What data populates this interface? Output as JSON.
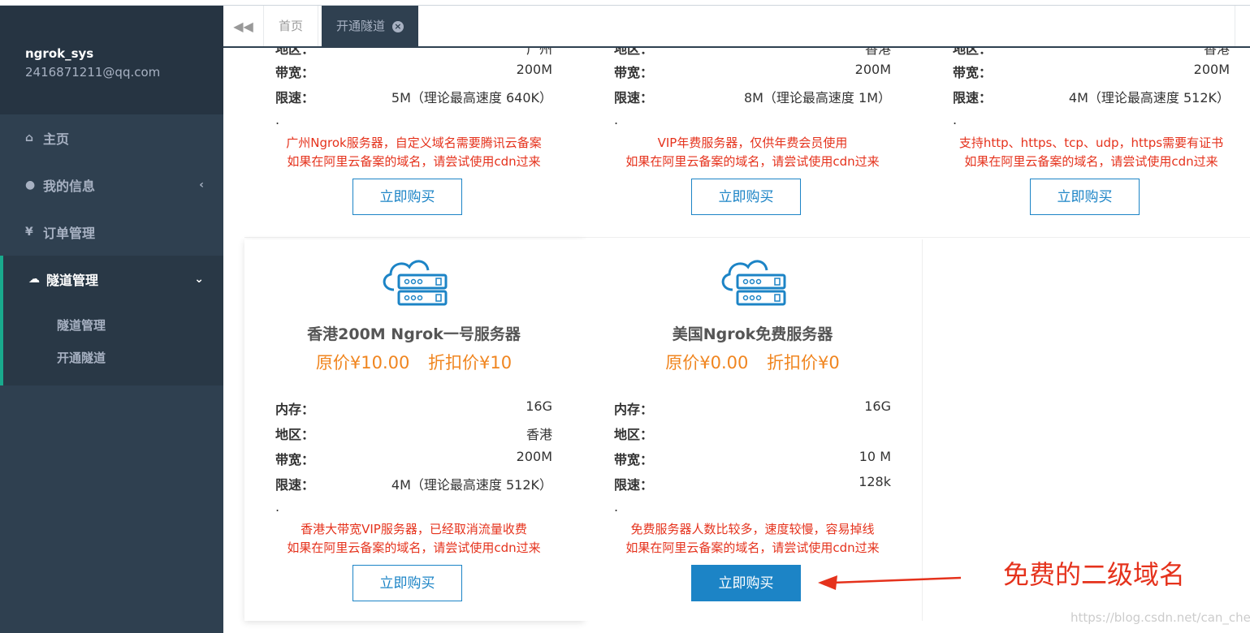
{
  "sidebar": {
    "username": "ngrok_sys",
    "email": "2416871211@qq.com",
    "items": [
      {
        "label": "主页",
        "icon": "home-icon"
      },
      {
        "label": "我的信息",
        "icon": "user-icon"
      },
      {
        "label": "订单管理",
        "icon": "yen-icon"
      },
      {
        "label": "隧道管理",
        "icon": "cloud-icon"
      }
    ],
    "submenu": [
      "隧道管理",
      "开通隧道"
    ]
  },
  "tabs": {
    "home": "首页",
    "active": "开通隧道"
  },
  "labels": {
    "memory": "内存：",
    "region": "地区：",
    "bandwidth": "带宽：",
    "speed": "限速：",
    "buy": "立即购买"
  },
  "top_cards": [
    {
      "region_partial": "广州",
      "bandwidth": "200M",
      "speed": "5M（理论最高速度 640K）",
      "dot": ".",
      "desc1": "广州Ngrok服务器，自定义域名需要腾讯云备案",
      "desc2": "如果在阿里云备案的域名，请尝试使用cdn过来"
    },
    {
      "region_partial": "香港",
      "bandwidth": "200M",
      "speed": "8M（理论最高速度 1M）",
      "dot": ".",
      "desc1": "VIP年费服务器，仅供年费会员使用",
      "desc2": "如果在阿里云备案的域名，请尝试使用cdn过来"
    },
    {
      "region_partial": "香港",
      "bandwidth": "200M",
      "speed": "4M（理论最高速度 512K）",
      "dot": ".",
      "desc1": "支持http、https、tcp、udp，https需要有证书",
      "desc2": "如果在阿里云备案的域名，请尝试使用cdn过来"
    }
  ],
  "bottom_cards": [
    {
      "title": "香港200M Ngrok一号服务器",
      "orig_price": "原价¥10.00",
      "disc_price": "折扣价¥10",
      "memory": "16G",
      "region": "香港",
      "bandwidth": "200M",
      "speed": "4M（理论最高速度 512K）",
      "dot": ".",
      "desc1": "香港大带宽VIP服务器，已经取消流量收费",
      "desc2": "如果在阿里云备案的域名，请尝试使用cdn过来"
    },
    {
      "title": "美国Ngrok免费服务器",
      "orig_price": "原价¥0.00",
      "disc_price": "折扣价¥0",
      "memory": "16G",
      "region": "",
      "bandwidth": "10 M",
      "speed": "128k",
      "dot": ".",
      "desc1": "免费服务器人数比较多，速度较慢，容易掉线",
      "desc2": "如果在阿里云备案的域名，请尝试使用cdn过来"
    }
  ],
  "annotation": "免费的二级域名",
  "watermark": "https://blog.csdn.net/can_chen",
  "colors": {
    "sidebar_bg": "#2f4050",
    "accent": "#19aa8d",
    "button": "#1c84c6",
    "desc_red": "#e5321c",
    "price_orange": "#f0851f"
  }
}
